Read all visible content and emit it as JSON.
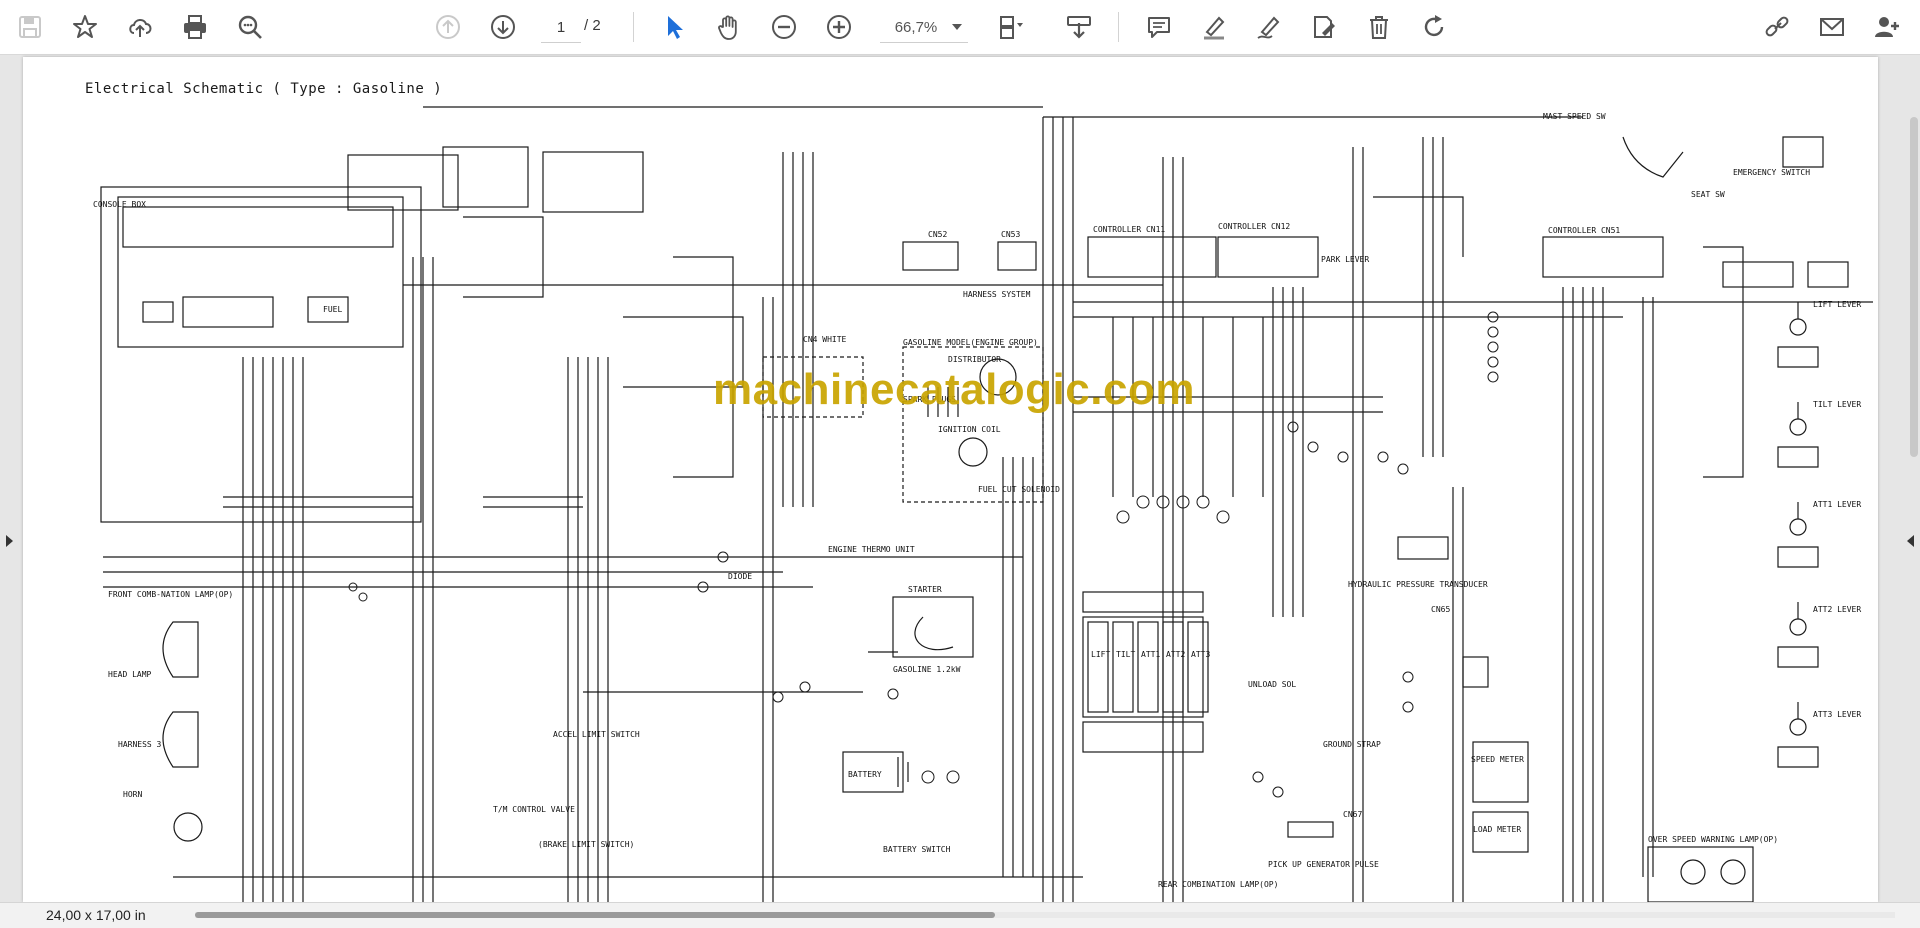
{
  "toolbar": {
    "page_current": "1",
    "page_total": "/ 2",
    "zoom": "66,7%",
    "accent": "#1e6fd9",
    "icons": [
      "save-icon",
      "bookmark-star-icon",
      "upload-cloud-icon",
      "print-icon",
      "zoom-search-icon",
      "page-up-icon",
      "page-down-icon",
      "select-cursor-icon",
      "hand-pan-icon",
      "zoom-out-icon",
      "zoom-in-icon",
      "page-fit-icon",
      "download-tray-icon",
      "comment-icon",
      "highlight-pen-icon",
      "draw-icon",
      "fill-sign-icon",
      "delete-icon",
      "rotate-icon",
      "share-link-icon",
      "email-icon",
      "add-user-icon"
    ]
  },
  "document": {
    "title": "Electrical Schematic ( Type : Gasoline )",
    "watermark": "machinecatalogic.com",
    "labels": {
      "console_box": "CONSOLE BOX",
      "front_lamp": "FRONT COMB-NATION LAMP(OP)",
      "head_lamp": "HEAD LAMP",
      "harness3": "HARNESS 3",
      "horn": "HORN",
      "cn4": "CN4 WHITE",
      "cn52": "CN52",
      "cn53": "CN53",
      "harness_system": "HARNESS SYSTEM",
      "gasoline_group": "GASOLINE MODEL(ENGINE GROUP)",
      "distributor": "DISTRIBUTOR",
      "spark": "SPARK PLUGS",
      "ignition": "IGNITION COIL",
      "fuel_cut": "FUEL CUT SOLENOID",
      "controller1": "CONTROLLER CN11",
      "controller2": "CONTROLLER CN12",
      "controller3": "CONTROLLER CN51",
      "park": "PARK LEVER",
      "mast": "MAST SPEED SW",
      "seat": "SEAT SW",
      "emergency": "EMERGENCY SWITCH",
      "lift": "LIFT LEVER",
      "tilt": "TILT LEVER",
      "att1": "ATT1 LEVER",
      "att2": "ATT2 LEVER",
      "att3": "ATT3 LEVER",
      "engine_thermo": "ENGINE THERMO UNIT",
      "diode": "DIODE",
      "starter": "STARTER",
      "gasoline_size": "GASOLINE 1.2kW",
      "battery": "BATTERY",
      "battery_sw": "BATTERY SWITCH",
      "hydraulic": "HYDRAULIC PRESSURE TRANSDUCER",
      "ground": "GROUND STRAP",
      "pickup": "PICK UP GENERATOR PULSE",
      "rear_lamp": "REAR COMBINATION LAMP(OP)",
      "speed_meter": "SPEED METER",
      "load_meter": "LOAD METER",
      "over_speed": "OVER SPEED WARNING LAMP(OP)",
      "unload": "UNLOAD SOL",
      "accel": "ACCEL LIMIT SWITCH",
      "tm": "T/M CONTROL VALVE",
      "brake": "(BRAKE LIMIT SWITCH)",
      "fuel": "FUEL",
      "cn67": "CN67",
      "cn65": "CN65",
      "lift_sol": "LIFT",
      "tilt_sol": "TILT",
      "att1_sol": "ATT1",
      "att2_sol": "ATT2",
      "att3_sol": "ATT3"
    }
  },
  "statusbar": {
    "page_size": "24,00 x 17,00 in"
  }
}
